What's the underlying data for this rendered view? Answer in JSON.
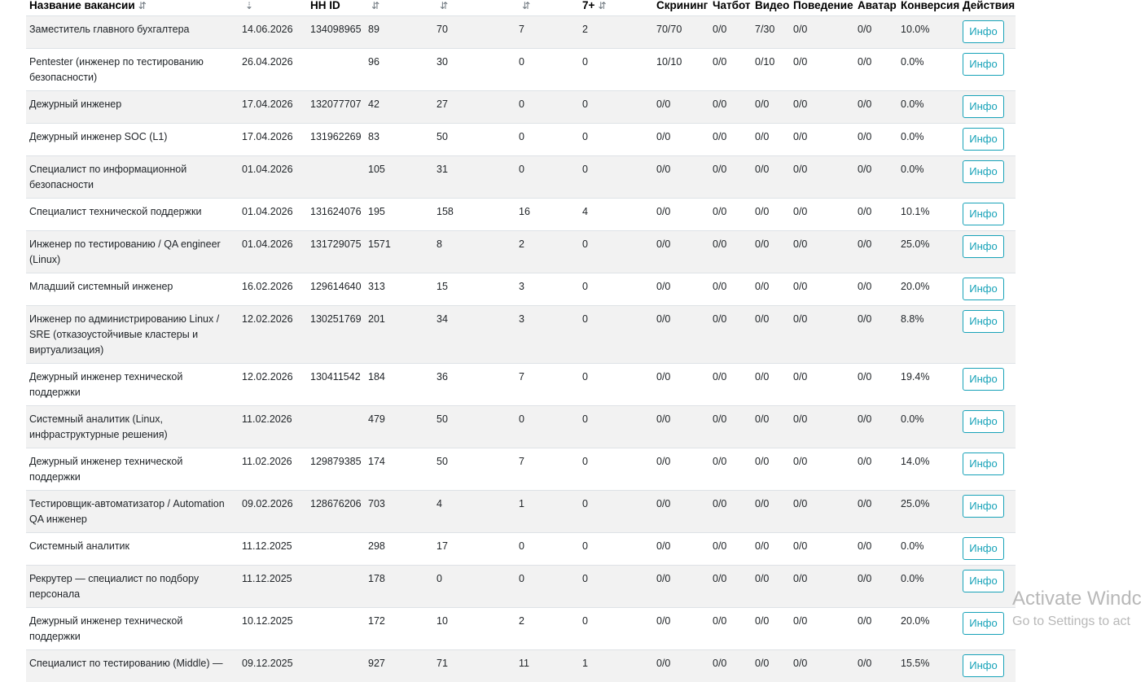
{
  "table": {
    "columns": [
      {
        "label": "Название вакансии",
        "sort_icon": "⇵"
      },
      {
        "label": "",
        "sort_icon": "⇣"
      },
      {
        "label": "HH ID",
        "sort_icon": ""
      },
      {
        "label": "",
        "sort_icon": "⇵"
      },
      {
        "label": "",
        "sort_icon": "⇵"
      },
      {
        "label": "",
        "sort_icon": "⇵"
      },
      {
        "label": "7+",
        "sort_icon": "⇵"
      },
      {
        "label": "Скрининг",
        "sort_icon": ""
      },
      {
        "label": "Чатбот",
        "sort_icon": ""
      },
      {
        "label": "Видео",
        "sort_icon": ""
      },
      {
        "label": "Поведение",
        "sort_icon": ""
      },
      {
        "label": "Аватар",
        "sort_icon": ""
      },
      {
        "label": "Конверсия",
        "sort_icon": ""
      },
      {
        "label": "Действия",
        "sort_icon": ""
      }
    ],
    "info_label": "Инфо",
    "rows": [
      {
        "name": "Заместитель главного бухгалтера",
        "date": "14.06.2026",
        "hh_id": "134098965",
        "c1": "89",
        "c2": "70",
        "c3": "7",
        "c4": "2",
        "screening": "70/70",
        "chatbot": "0/0",
        "video": "7/30",
        "behavior": "0/0",
        "avatar": "0/0",
        "conversion": "10.0%"
      },
      {
        "name": "Pentester (инженер по тестированию безопасности)",
        "date": "26.04.2026",
        "hh_id": "",
        "c1": "96",
        "c2": "30",
        "c3": "0",
        "c4": "0",
        "screening": "10/10",
        "chatbot": "0/0",
        "video": "0/10",
        "behavior": "0/0",
        "avatar": "0/0",
        "conversion": "0.0%"
      },
      {
        "name": "Дежурный инженер",
        "date": "17.04.2026",
        "hh_id": "132077707",
        "c1": "42",
        "c2": "27",
        "c3": "0",
        "c4": "0",
        "screening": "0/0",
        "chatbot": "0/0",
        "video": "0/0",
        "behavior": "0/0",
        "avatar": "0/0",
        "conversion": "0.0%"
      },
      {
        "name": "Дежурный инженер SOC (L1)",
        "date": "17.04.2026",
        "hh_id": "131962269",
        "c1": "83",
        "c2": "50",
        "c3": "0",
        "c4": "0",
        "screening": "0/0",
        "chatbot": "0/0",
        "video": "0/0",
        "behavior": "0/0",
        "avatar": "0/0",
        "conversion": "0.0%"
      },
      {
        "name": "Специалист по информационной безопасности",
        "date": "01.04.2026",
        "hh_id": "",
        "c1": "105",
        "c2": "31",
        "c3": "0",
        "c4": "0",
        "screening": "0/0",
        "chatbot": "0/0",
        "video": "0/0",
        "behavior": "0/0",
        "avatar": "0/0",
        "conversion": "0.0%"
      },
      {
        "name": "Специалист технической поддержки",
        "date": "01.04.2026",
        "hh_id": "131624076",
        "c1": "195",
        "c2": "158",
        "c3": "16",
        "c4": "4",
        "screening": "0/0",
        "chatbot": "0/0",
        "video": "0/0",
        "behavior": "0/0",
        "avatar": "0/0",
        "conversion": "10.1%"
      },
      {
        "name": "Инженер по тестированию / QA engineer (Linux)",
        "date": "01.04.2026",
        "hh_id": "131729075",
        "c1": "1571",
        "c2": "8",
        "c3": "2",
        "c4": "0",
        "screening": "0/0",
        "chatbot": "0/0",
        "video": "0/0",
        "behavior": "0/0",
        "avatar": "0/0",
        "conversion": "25.0%"
      },
      {
        "name": "Младший системный инженер",
        "date": "16.02.2026",
        "hh_id": "129614640",
        "c1": "313",
        "c2": "15",
        "c3": "3",
        "c4": "0",
        "screening": "0/0",
        "chatbot": "0/0",
        "video": "0/0",
        "behavior": "0/0",
        "avatar": "0/0",
        "conversion": "20.0%"
      },
      {
        "name": "Инженер по администрированию Linux / SRE (отказоустойчивые кластеры и виртуализация)",
        "date": "12.02.2026",
        "hh_id": "130251769",
        "c1": "201",
        "c2": "34",
        "c3": "3",
        "c4": "0",
        "screening": "0/0",
        "chatbot": "0/0",
        "video": "0/0",
        "behavior": "0/0",
        "avatar": "0/0",
        "conversion": "8.8%"
      },
      {
        "name": "Дежурный инженер технической поддержки",
        "date": "12.02.2026",
        "hh_id": "130411542",
        "c1": "184",
        "c2": "36",
        "c3": "7",
        "c4": "0",
        "screening": "0/0",
        "chatbot": "0/0",
        "video": "0/0",
        "behavior": "0/0",
        "avatar": "0/0",
        "conversion": "19.4%"
      },
      {
        "name": "Системный аналитик (Linux, инфраструктурные решения)",
        "date": "11.02.2026",
        "hh_id": "",
        "c1": "479",
        "c2": "50",
        "c3": "0",
        "c4": "0",
        "screening": "0/0",
        "chatbot": "0/0",
        "video": "0/0",
        "behavior": "0/0",
        "avatar": "0/0",
        "conversion": "0.0%"
      },
      {
        "name": "Дежурный инженер технической поддержки",
        "date": "11.02.2026",
        "hh_id": "129879385",
        "c1": "174",
        "c2": "50",
        "c3": "7",
        "c4": "0",
        "screening": "0/0",
        "chatbot": "0/0",
        "video": "0/0",
        "behavior": "0/0",
        "avatar": "0/0",
        "conversion": "14.0%"
      },
      {
        "name": "Тестировщик-автоматизатор / Automation QA инженер",
        "date": "09.02.2026",
        "hh_id": "128676206",
        "c1": "703",
        "c2": "4",
        "c3": "1",
        "c4": "0",
        "screening": "0/0",
        "chatbot": "0/0",
        "video": "0/0",
        "behavior": "0/0",
        "avatar": "0/0",
        "conversion": "25.0%"
      },
      {
        "name": "Системный аналитик",
        "date": "11.12.2025",
        "hh_id": "",
        "c1": "298",
        "c2": "17",
        "c3": "0",
        "c4": "0",
        "screening": "0/0",
        "chatbot": "0/0",
        "video": "0/0",
        "behavior": "0/0",
        "avatar": "0/0",
        "conversion": "0.0%"
      },
      {
        "name": "Рекрутер — специалист по подбору персонала",
        "date": "11.12.2025",
        "hh_id": "",
        "c1": "178",
        "c2": "0",
        "c3": "0",
        "c4": "0",
        "screening": "0/0",
        "chatbot": "0/0",
        "video": "0/0",
        "behavior": "0/0",
        "avatar": "0/0",
        "conversion": "0.0%"
      },
      {
        "name": "Дежурный инженер технической поддержки",
        "date": "10.12.2025",
        "hh_id": "",
        "c1": "172",
        "c2": "10",
        "c3": "2",
        "c4": "0",
        "screening": "0/0",
        "chatbot": "0/0",
        "video": "0/0",
        "behavior": "0/0",
        "avatar": "0/0",
        "conversion": "20.0%"
      },
      {
        "name": "Специалист по тестированию (Middle) —",
        "date": "09.12.2025",
        "hh_id": "",
        "c1": "927",
        "c2": "71",
        "c3": "11",
        "c4": "1",
        "screening": "0/0",
        "chatbot": "0/0",
        "video": "0/0",
        "behavior": "0/0",
        "avatar": "0/0",
        "conversion": "15.5%"
      }
    ]
  },
  "watermark": {
    "title": "Activate Windc",
    "subtitle": "Go to Settings to act"
  }
}
